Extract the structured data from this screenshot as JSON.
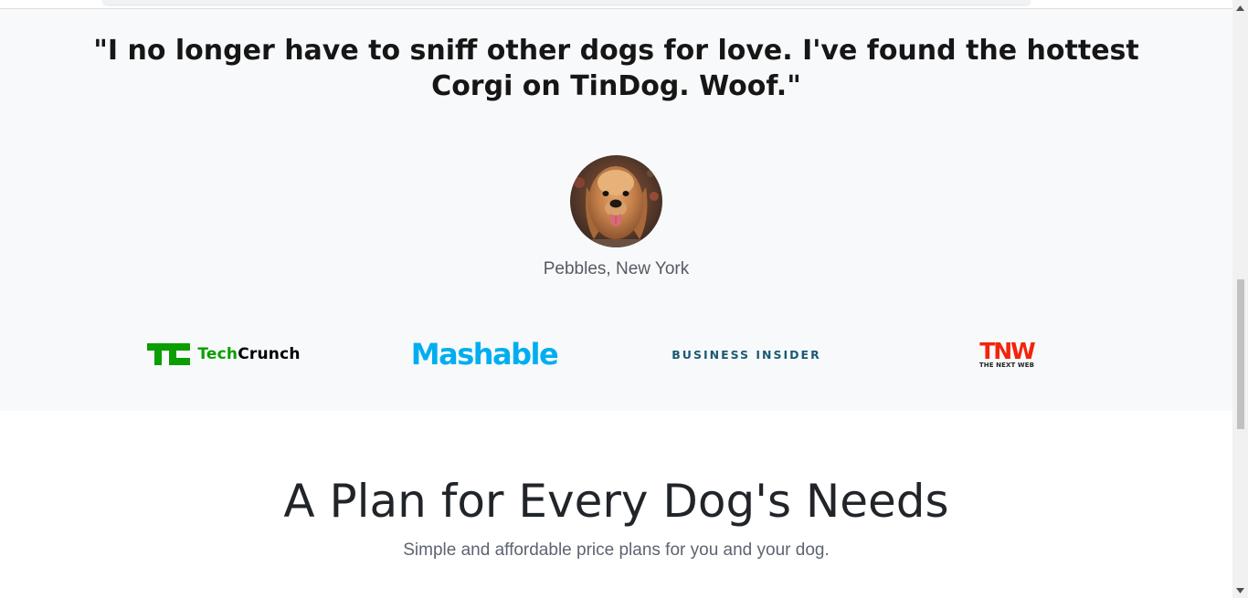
{
  "testimonial": {
    "quote": "\"I no longer have to sniff other dogs for love. I've found the hottest Corgi on TinDog. Woof.\"",
    "author": "Pebbles, New York",
    "avatar_icon": "golden-retriever-photo"
  },
  "press": {
    "techcrunch": {
      "mark": "TC",
      "name_prefix": "Tech",
      "name_suffix": "Crunch",
      "color": "#0a9e01"
    },
    "mashable": {
      "name": "Mashable",
      "color": "#00aeef"
    },
    "business_insider": {
      "name": "BUSINESS INSIDER",
      "color": "#1a5a73"
    },
    "tnw": {
      "mark": "TNW",
      "name": "THE NEXT WEB",
      "color": "#f2250c"
    }
  },
  "pricing": {
    "title": "A Plan for Every Dog's Needs",
    "subtitle": "Simple and affordable price plans for you and your dog."
  },
  "colors": {
    "section_bg": "#f8f9fb",
    "page_bg": "#ffffff",
    "text_dark": "#212529",
    "text_muted": "#5d6470"
  },
  "scrollbar": {
    "up_icon": "triangle-up-icon",
    "down_icon": "triangle-down-icon"
  }
}
